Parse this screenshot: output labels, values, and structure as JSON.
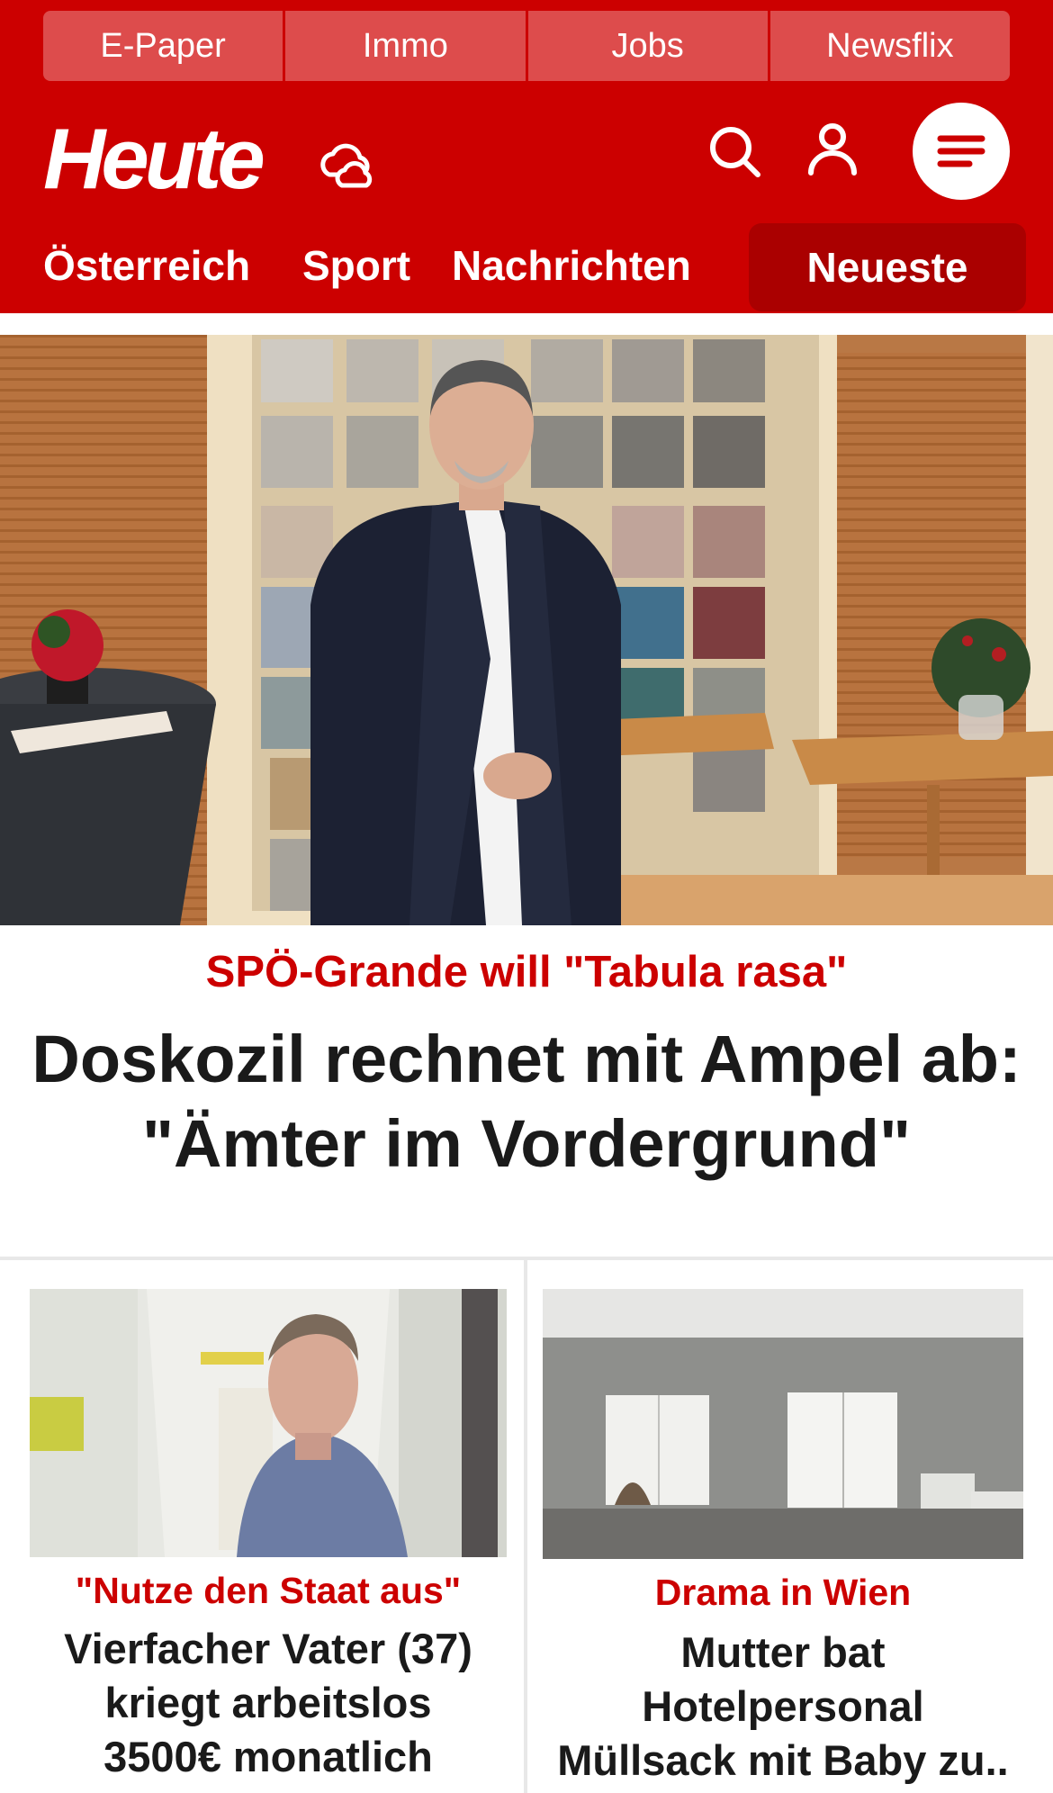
{
  "topnav": [
    "E-Paper",
    "Immo",
    "Jobs",
    "Newsflix"
  ],
  "brand": {
    "logo": "Heute"
  },
  "icons": {
    "weather": "cloud-sun-icon",
    "search": "search-icon",
    "account": "user-icon",
    "menu": "menu-icon"
  },
  "sections": {
    "austria": "Österreich",
    "sport": "Sport",
    "news": "Nachrichten",
    "latest": "Neueste"
  },
  "hero": {
    "kicker": "SPÖ-Grande will \"Tabula rasa\"",
    "headline_line1": "Doskozil rechnet mit Ampel ab:",
    "headline_line2": "\"Ämter im Vordergrund\""
  },
  "articles": [
    {
      "kicker": "\"Nutze den Staat aus\"",
      "title_lines": [
        "Vierfacher Vater (37)",
        "kriegt arbeitslos",
        "3500€ monatlich"
      ]
    },
    {
      "kicker": "Drama in Wien",
      "title_lines": [
        "Mutter bat",
        "Hotelpersonal",
        "Müllsack mit Baby zu.."
      ]
    }
  ],
  "colors": {
    "brand_red": "#cc0000",
    "tab_red": "#dd4c4c",
    "active_red": "#aa0000",
    "text_dark": "#1a1a1a"
  }
}
